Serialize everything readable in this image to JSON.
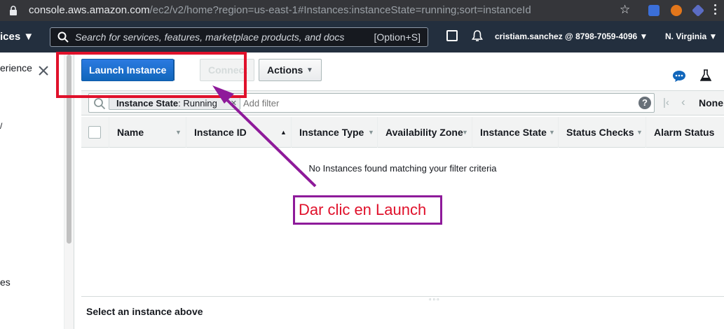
{
  "browser": {
    "url_host": "console.aws.amazon.com",
    "url_path": "/ec2/v2/home?region=us-east-1#Instances:instanceState=running;sort=instanceId"
  },
  "aws_nav": {
    "services_label": "ices ▼",
    "search_placeholder": "Search for services, features, marketplace products, and docs",
    "search_shortcut": "[Option+S]",
    "account": "cristiam.sanchez @ 8798-7059-4096  ▼",
    "region": "N. Virginia  ▼"
  },
  "sidebar": {
    "title_fragment": "erience",
    "mark_fragment": "/",
    "item_fragment": "es"
  },
  "toolbar": {
    "launch_label": "Launch Instance",
    "connect_label": "Connect",
    "actions_label": "Actions"
  },
  "filter": {
    "token_key": "Instance State",
    "token_value": ": Running",
    "add_placeholder": "Add filter",
    "help": "?",
    "pagination_label": "None"
  },
  "table": {
    "columns": [
      "Name",
      "Instance ID",
      "Instance Type",
      "Availability Zone",
      "Instance State",
      "Status Checks",
      "Alarm Status"
    ],
    "empty_message": "No Instances found matching your filter criteria"
  },
  "bottom": {
    "select_message": "Select an instance above"
  },
  "annotation": {
    "callout_text": "Dar clic en Launch",
    "box_color": "#e0112b",
    "arrow_color": "#8e1a9a"
  },
  "colors": {
    "aws_nav_bg": "#232f3e",
    "primary_button": "#1166bb"
  }
}
